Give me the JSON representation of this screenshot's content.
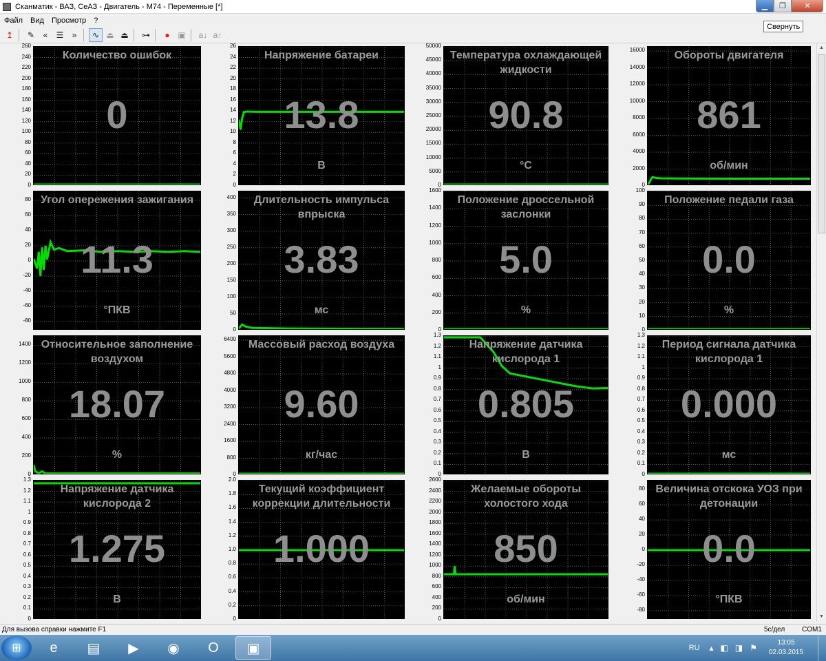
{
  "window": {
    "title": "Сканматик - ВАЗ, СеАЗ - Двигатель - М74 - Переменные [*]",
    "minimize_tooltip": "Свернуть"
  },
  "menu": [
    "Файл",
    "Вид",
    "Просмотр",
    "?"
  ],
  "toolbar": {
    "items": [
      {
        "name": "connect-icon",
        "glyph": "↥",
        "cls": "red"
      },
      {
        "name": "sep",
        "glyph": "",
        "cls": "sep"
      },
      {
        "name": "edit-icon",
        "glyph": "✎",
        "cls": ""
      },
      {
        "name": "prev-icon",
        "glyph": "«",
        "cls": ""
      },
      {
        "name": "list-icon",
        "glyph": "☰",
        "cls": ""
      },
      {
        "name": "next-icon",
        "glyph": "»",
        "cls": ""
      },
      {
        "name": "sep",
        "glyph": "",
        "cls": "sep"
      },
      {
        "name": "graph-mode-icon",
        "glyph": "∿",
        "cls": "active"
      },
      {
        "name": "graph-up-icon",
        "glyph": "⏏",
        "cls": "disabled"
      },
      {
        "name": "graph-down-icon",
        "glyph": "⏏",
        "cls": ""
      },
      {
        "name": "sep",
        "glyph": "",
        "cls": "sep"
      },
      {
        "name": "pulse-icon",
        "glyph": "⊶",
        "cls": ""
      },
      {
        "name": "sep",
        "glyph": "",
        "cls": "sep"
      },
      {
        "name": "record-icon",
        "glyph": "●",
        "cls": "red"
      },
      {
        "name": "save-icon",
        "glyph": "▣",
        "cls": "disabled"
      },
      {
        "name": "sep",
        "glyph": "",
        "cls": "sep"
      },
      {
        "name": "font-down-icon",
        "glyph": "a↓",
        "cls": "disabled"
      },
      {
        "name": "font-up-icon",
        "glyph": "a↑",
        "cls": "disabled"
      }
    ]
  },
  "panels": [
    {
      "title": "Количество ошибок",
      "value": "0",
      "unit": "",
      "ticks": [
        "0",
        "20",
        "40",
        "60",
        "80",
        "100",
        "120",
        "140",
        "160",
        "180",
        "200",
        "220",
        "240",
        "260"
      ],
      "ymin": 0,
      "ymax": 260,
      "series": [
        [
          0,
          0
        ],
        [
          1,
          0
        ]
      ]
    },
    {
      "title": "Напряжение батареи",
      "value": "13.8",
      "unit": "В",
      "ticks": [
        "0",
        "2",
        "4",
        "6",
        "8",
        "10",
        "12",
        "14",
        "16",
        "18",
        "20",
        "22",
        "24",
        "26"
      ],
      "ymin": 0,
      "ymax": 26,
      "series": [
        [
          0,
          12.4
        ],
        [
          0.01,
          10.5
        ],
        [
          0.02,
          12.6
        ],
        [
          0.03,
          13.8
        ],
        [
          0.05,
          13.9
        ],
        [
          0.1,
          13.85
        ],
        [
          0.3,
          13.85
        ],
        [
          0.6,
          13.85
        ],
        [
          1,
          13.85
        ]
      ]
    },
    {
      "title": "Температура охлаждающей жидкости",
      "value": "90.8",
      "unit": "°С",
      "ticks": [
        "0",
        "5000",
        "10000",
        "15000",
        "20000",
        "25000",
        "30000",
        "35000",
        "40000",
        "45000",
        "50000"
      ],
      "ymin": 0,
      "ymax": 50000,
      "series": [
        [
          0,
          90
        ],
        [
          1,
          91
        ]
      ]
    },
    {
      "title": "Обороты  двигателя",
      "value": "861",
      "unit": "об/мин",
      "ticks": [
        "0",
        "2000",
        "4000",
        "6000",
        "8000",
        "10000",
        "12000",
        "14000",
        "16000"
      ],
      "ymin": 0,
      "ymax": 16500,
      "series": [
        [
          0,
          0
        ],
        [
          0.01,
          400
        ],
        [
          0.02,
          800
        ],
        [
          0.03,
          1050
        ],
        [
          0.05,
          950
        ],
        [
          0.08,
          900
        ],
        [
          0.2,
          870
        ],
        [
          0.5,
          860
        ],
        [
          1,
          860
        ]
      ]
    },
    {
      "title": "Угол опережения зажигания",
      "value": "11.3",
      "unit": "°ПКВ",
      "ticks": [
        "-80",
        "-60",
        "-40",
        "-20",
        "0",
        "20",
        "40",
        "60",
        "80"
      ],
      "ymin": -92,
      "ymax": 92,
      "series": [
        [
          0,
          3
        ],
        [
          0.02,
          -10
        ],
        [
          0.03,
          12
        ],
        [
          0.04,
          -20
        ],
        [
          0.05,
          18
        ],
        [
          0.06,
          -12
        ],
        [
          0.07,
          20
        ],
        [
          0.08,
          2
        ],
        [
          0.1,
          25
        ],
        [
          0.12,
          15
        ],
        [
          0.15,
          17
        ],
        [
          0.2,
          13
        ],
        [
          0.3,
          14
        ],
        [
          0.4,
          12
        ],
        [
          0.5,
          13
        ],
        [
          0.6,
          12
        ],
        [
          0.7,
          13
        ],
        [
          0.8,
          12
        ],
        [
          0.9,
          13
        ],
        [
          1,
          12
        ]
      ]
    },
    {
      "title": "Длительность импульса впрыска",
      "value": "3.83",
      "unit": "мс",
      "ticks": [
        "0",
        "50",
        "100",
        "150",
        "200",
        "250",
        "300",
        "350",
        "400"
      ],
      "ymin": 0,
      "ymax": 420,
      "series": [
        [
          0,
          6
        ],
        [
          0.02,
          18
        ],
        [
          0.04,
          12
        ],
        [
          0.08,
          8
        ],
        [
          0.3,
          6
        ],
        [
          0.7,
          5
        ],
        [
          1,
          5
        ]
      ]
    },
    {
      "title": "Положение дроссельной заслонки",
      "value": "5.0",
      "unit": "%",
      "ticks": [
        "0",
        "200",
        "400",
        "600",
        "800",
        "1000",
        "1200",
        "1400",
        "1600"
      ],
      "ymin": 0,
      "ymax": 1600,
      "series": [
        [
          0,
          5
        ],
        [
          1,
          5
        ]
      ]
    },
    {
      "title": "Положение педали газа",
      "value": "0.0",
      "unit": "%",
      "ticks": [
        "0",
        "10",
        "20",
        "30",
        "40",
        "50",
        "60",
        "70",
        "80",
        "90",
        "100"
      ],
      "ymin": 0,
      "ymax": 100,
      "series": [
        [
          0,
          0
        ],
        [
          1,
          0
        ]
      ]
    },
    {
      "title": "Относительное заполнение воздухом",
      "value": "18.07",
      "unit": "%",
      "ticks": [
        "0",
        "200",
        "400",
        "600",
        "800",
        "1000",
        "1200",
        "1400"
      ],
      "ymin": 0,
      "ymax": 1500,
      "series": [
        [
          0,
          110
        ],
        [
          0.01,
          40
        ],
        [
          0.03,
          20
        ],
        [
          0.05,
          40
        ],
        [
          0.07,
          18
        ],
        [
          0.2,
          18
        ],
        [
          1,
          18
        ]
      ]
    },
    {
      "title": "Массовый расход воздуха",
      "value": "9.60",
      "unit": "кг/час",
      "ticks": [
        "0",
        "800",
        "1600",
        "2400",
        "3200",
        "4000",
        "4800",
        "5600",
        "6400"
      ],
      "ymin": 0,
      "ymax": 6600,
      "series": [
        [
          0,
          10
        ],
        [
          1,
          10
        ]
      ]
    },
    {
      "title": "Напряжение датчика кислорода 1",
      "value": "0.805",
      "unit": "В",
      "ticks": [
        "0",
        "0.1",
        "0.2",
        "0.3",
        "0.4",
        "0.5",
        "0.6",
        "0.7",
        "0.8",
        "0.9",
        "1",
        "1.1",
        "1.2",
        "1.3"
      ],
      "ymin": 0,
      "ymax": 1.3,
      "series": [
        [
          0,
          1.3
        ],
        [
          0.22,
          1.3
        ],
        [
          0.3,
          1.15
        ],
        [
          0.35,
          1.02
        ],
        [
          0.4,
          0.95
        ],
        [
          0.5,
          0.92
        ],
        [
          0.6,
          0.89
        ],
        [
          0.7,
          0.86
        ],
        [
          0.8,
          0.83
        ],
        [
          0.9,
          0.81
        ],
        [
          1,
          0.815
        ]
      ]
    },
    {
      "title": "Период сигнала датчика кислорода 1",
      "value": "0.000",
      "unit": "мс",
      "ticks": [
        "0",
        "0.1",
        "0.2",
        "0.3",
        "0.4",
        "0.5",
        "0.6",
        "0.7",
        "0.8",
        "0.9",
        "1",
        "1.1",
        "1.2",
        "1.3"
      ],
      "ymin": 0,
      "ymax": 1.3,
      "series": [
        [
          0,
          0
        ],
        [
          1,
          0
        ]
      ]
    },
    {
      "title": "Напряжение датчика кислорода 2",
      "value": "1.275",
      "unit": "В",
      "ticks": [
        "0",
        "0.1",
        "0.2",
        "0.3",
        "0.4",
        "0.5",
        "0.6",
        "0.7",
        "0.8",
        "0.9",
        "1",
        "1.1",
        "1.2",
        "1.3"
      ],
      "ymin": 0,
      "ymax": 1.3,
      "series": [
        [
          0,
          1.275
        ],
        [
          1,
          1.275
        ]
      ]
    },
    {
      "title": "Текущий коэффициент коррекции длительности",
      "value": "1.000",
      "unit": "",
      "ticks": [
        "0",
        "0.2",
        "0.4",
        "0.6",
        "0.8",
        "1.0",
        "1.2",
        "1.4",
        "1.6",
        "1.8",
        "2.0"
      ],
      "ymin": 0,
      "ymax": 2.0,
      "series": [
        [
          0,
          1.0
        ],
        [
          1,
          1.0
        ]
      ]
    },
    {
      "title": "Желаемые обороты холостого хода",
      "value": "850",
      "unit": "об/мин",
      "ticks": [
        "0",
        "200",
        "400",
        "600",
        "800",
        "1000",
        "1200",
        "1400",
        "1600",
        "1800",
        "2000",
        "2200",
        "2400",
        "2600"
      ],
      "ymin": 0,
      "ymax": 2600,
      "series": [
        [
          0,
          850
        ],
        [
          0.06,
          850
        ],
        [
          0.065,
          1000
        ],
        [
          0.07,
          850
        ],
        [
          1,
          850
        ]
      ]
    },
    {
      "title": "Величина отскока УОЗ при детонации",
      "value": "0.0",
      "unit": "°ПКВ",
      "ticks": [
        "-80",
        "-60",
        "-40",
        "-20",
        "0",
        "20",
        "40",
        "60",
        "80"
      ],
      "ymin": -92,
      "ymax": 92,
      "series": [
        [
          0,
          0
        ],
        [
          1,
          0
        ]
      ]
    }
  ],
  "status": {
    "hint": "Для вызова справки нажмите F1",
    "scale": "5с/дел",
    "port": "COM1"
  },
  "taskbar": {
    "apps": [
      {
        "name": "ie-icon",
        "glyph": "e"
      },
      {
        "name": "explorer-icon",
        "glyph": "▤"
      },
      {
        "name": "media-player-icon",
        "glyph": "▶"
      },
      {
        "name": "chrome-icon",
        "glyph": "◉"
      },
      {
        "name": "opera-icon",
        "glyph": "O"
      },
      {
        "name": "scanmatik-icon",
        "glyph": "▣",
        "active": true
      }
    ],
    "lang": "RU",
    "time": "13:05",
    "date": "02.03.2015"
  },
  "colors": {
    "trace": "#00e000",
    "grid": "#5a5a5a",
    "plot_bg": "#000000",
    "overlay_text": "#9a9a9a"
  }
}
